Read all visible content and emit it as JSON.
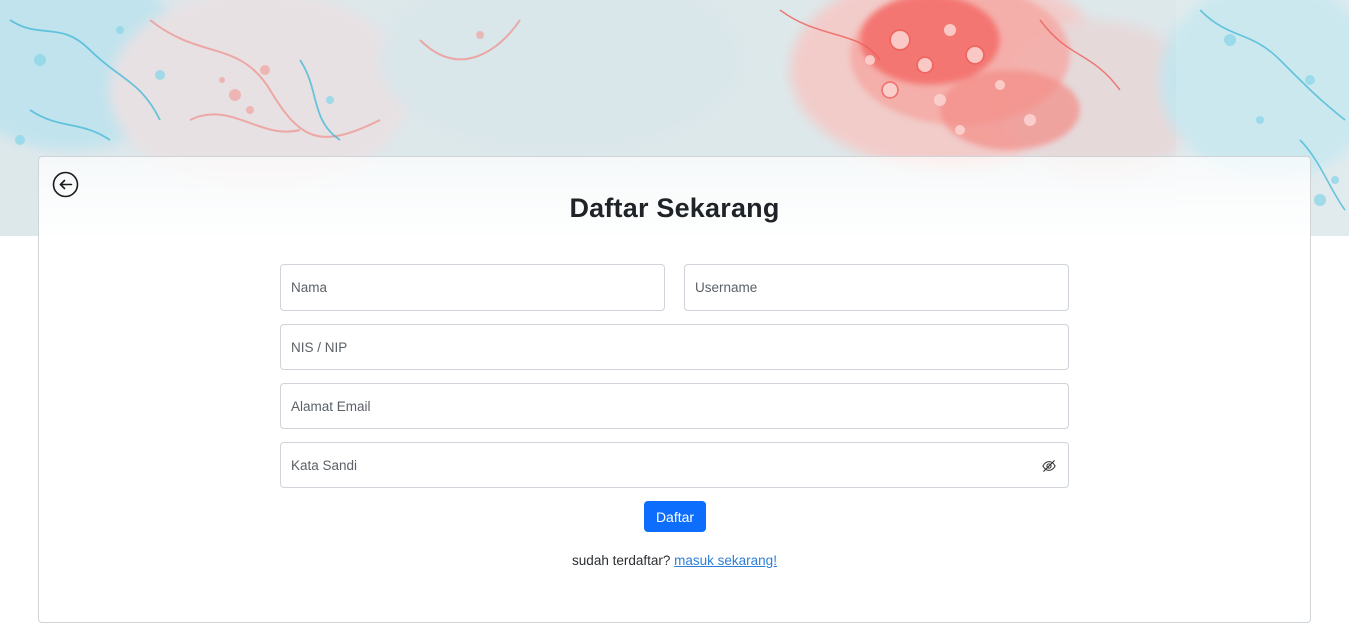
{
  "form": {
    "title": "Daftar Sekarang",
    "fields": {
      "nama_placeholder": "Nama",
      "username_placeholder": "Username",
      "nis_nip_placeholder": "NIS / NIP",
      "email_placeholder": "Alamat Email",
      "password_placeholder": "Kata Sandi"
    },
    "submit_label": "Daftar",
    "login_prompt": "sudah terdaftar?",
    "login_link": "masuk sekarang!"
  },
  "icons": {
    "back": "arrow-left-circle-icon",
    "password_toggle": "eye-slash-icon"
  },
  "colors": {
    "primary": "#0d6efd",
    "link": "#2d7fd9",
    "border": "#ced4da",
    "hero_red": "#f26a6a",
    "hero_cyan": "#3fc3df"
  }
}
